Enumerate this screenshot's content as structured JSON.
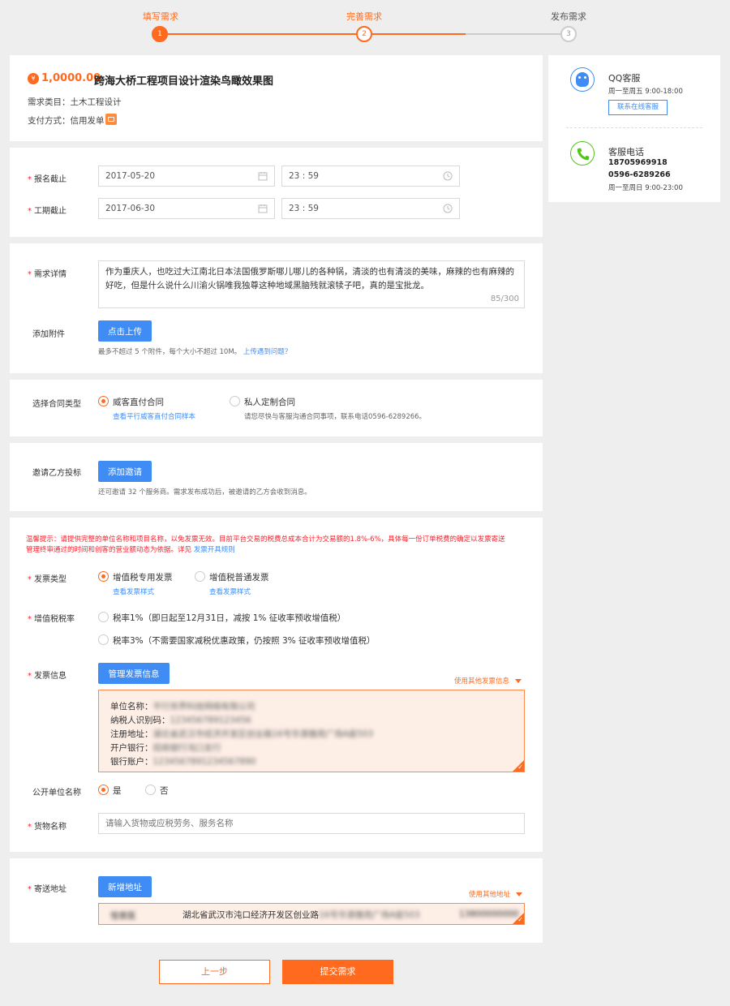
{
  "steps": [
    {
      "label": "填写需求",
      "num": "1"
    },
    {
      "label": "完善需求",
      "num": "2"
    },
    {
      "label": "发布需求",
      "num": "3"
    }
  ],
  "project": {
    "price_icon": "¥",
    "price": "1,0000.00",
    "title": "跨海大桥工程项目设计渲染鸟瞰效果图",
    "category_label": "需求类目：",
    "category": "土木工程设计",
    "payment_label": "支付方式：",
    "payment": "信用发单"
  },
  "deadline": {
    "signup_label": "报名截止",
    "signup_date": "2017-05-20",
    "signup_time": "23 : 59",
    "work_label": "工期截止",
    "work_date": "2017-06-30",
    "work_time": "23 : 59"
  },
  "detail": {
    "label": "需求详情",
    "text": "作为重庆人，也吃过大江南北日本法国俄罗斯哪儿哪儿的各种锅，清淡的也有清淡的美味，麻辣的也有麻辣的好吃，但是什么说什么川渝火锅唯我独尊这种地域黑脑残就滚犊子吧，真的是宝批龙。",
    "counter": "85/300",
    "attach_label": "添加附件",
    "upload_btn": "点击上传",
    "upload_hint": "最多不超过 5 个附件，每个大小不超过 10M。",
    "upload_link": "上传遇到问题？"
  },
  "contract": {
    "label": "选择合同类型",
    "option1": "威客直付合同",
    "option1_link": "查看平行威客直付合同样本",
    "option2": "私人定制合同",
    "option2_hint": "请您尽快与客服沟通合同事项，联系电话0596-6289266。"
  },
  "invite": {
    "label": "邀请乙方投标",
    "btn": "添加邀请",
    "hint": "还可邀请 32 个服务商。需求发布成功后，被邀请的乙方会收到消息。"
  },
  "invoice": {
    "notice_line1": "温馨提示：请提供完整的单位名称和项目名称，以免发票无效。目前平台交易的税费总成本合计为交易额的1.8%-6%，具体每一份订单税费的确定以发票寄送",
    "notice_line2a": "管理终审通过的时间和创客的营业额动态为依据。详见",
    "notice_link": "发票开具规则",
    "type_label": "发票类型",
    "type1": "增值税专用发票",
    "type1_link": "查看发票样式",
    "type2": "增值税普通发票",
    "type2_link": "查看发票样式",
    "rate_label": "增值税税率",
    "rate1": "税率1%（即日起至12月31日，减按 1% 征收率预收增值税）",
    "rate2": "税率3%（不需要国家减税优惠政策，仍按照 3% 征收率预收增值税）",
    "info_label": "发票信息",
    "manage_btn": "管理发票信息",
    "other_info": "使用其他发票信息",
    "f1_label": "单位名称：",
    "f1_value": "平行世界科技网络有限公司",
    "f2_label": "纳税人识别码：",
    "f2_value": "123456789123456",
    "f3_label": "注册地址：",
    "f3_value": "湖北省武汉市经济开发区创业路16号华源雅苑广场A座503",
    "f4_label": "开户银行：",
    "f4_value": "招商银行沌口支行",
    "f5_label": "银行账户：",
    "f5_value": "1234567891234567890",
    "public_label": "公开单位名称",
    "public_yes": "是",
    "public_no": "否",
    "goods_label": "货物名称",
    "goods_placeholder": "请输入货物或应税劳务、服务名称"
  },
  "address": {
    "label": "寄送地址",
    "add_btn": "新增地址",
    "other": "使用其他地址",
    "name": "怪兽医",
    "addr_clear": "湖北省武汉市沌口经济开发区创业路",
    "addr_blur": "16号华源雅苑广场A座503",
    "phone": "13800000000"
  },
  "actions": {
    "prev": "上一步",
    "submit": "提交需求"
  },
  "service": {
    "qq_title": "QQ客服",
    "qq_hours": "周一至周五  9:00-18:00",
    "qq_btn": "联系在线客服",
    "phone_title": "客服电话",
    "phone1": "18705969918",
    "phone2": "0596-6289266",
    "phone_hours": "周一至周日  9:00-23:00"
  },
  "colors": {
    "accent": "#ff6a1e",
    "primary": "#3f8cf5",
    "required": "#f5222d"
  }
}
